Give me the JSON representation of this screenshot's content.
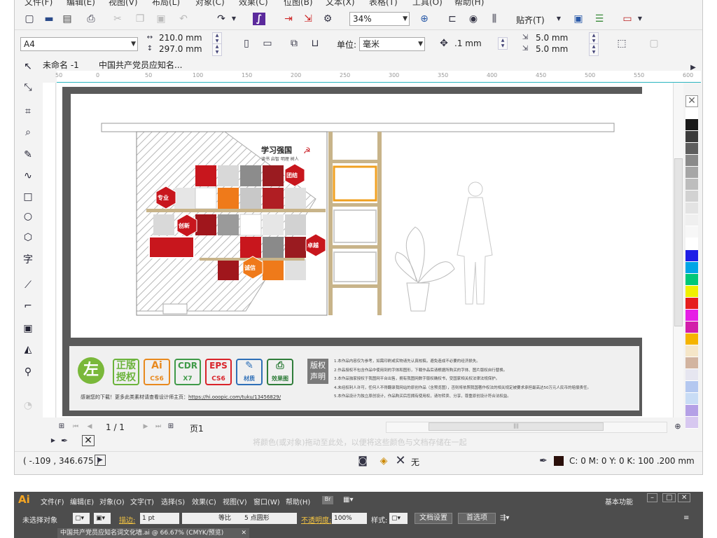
{
  "corel": {
    "menu": [
      "文件(F)",
      "编辑(E)",
      "视图(V)",
      "布局(L)",
      "对象(C)",
      "效果(C)",
      "位图(B)",
      "文本(X)",
      "表格(T)",
      "工具(O)",
      "帮助(H)"
    ],
    "toolbar1": {
      "zoom": "34%",
      "snap": "贴齐(T)"
    },
    "propbar": {
      "page_size": "A4",
      "width": "210.0 mm",
      "height": "297.0 mm",
      "units_label": "单位:",
      "units": "毫米",
      "nudge": ".1 mm",
      "dup_x": "5.0 mm",
      "dup_y": "5.0 mm"
    },
    "doc_tabs": [
      "未命名 -1",
      "中国共产党员应知名..."
    ],
    "ruler_marks": [
      "50",
      "0",
      "50",
      "100",
      "150",
      "200",
      "250",
      "300",
      "350",
      "400",
      "450",
      "500",
      "550",
      "600"
    ],
    "artwork": {
      "title": "学习强国",
      "subtitle": "读书 启智 明理 树人",
      "hex_labels": [
        "专业",
        "创新",
        "团结",
        "诚信",
        "卓越"
      ]
    },
    "footer": {
      "logo_char": "左",
      "badges": [
        {
          "top": "正版",
          "bottom": "授权",
          "color": "#6bb33b"
        },
        {
          "top": "Ai",
          "bottom": "CS6",
          "color": "#e8891e"
        },
        {
          "top": "CDR",
          "bottom": "X7",
          "color": "#3f9a48"
        },
        {
          "top": "EPS",
          "bottom": "CS6",
          "color": "#d9232a"
        },
        {
          "top": "✎",
          "bottom": "材质",
          "color": "#2e6fb7"
        },
        {
          "top": "⎙",
          "bottom": "效果图",
          "color": "#2f7d3a"
        }
      ],
      "copyright_badge": "版权声明",
      "thanks": "感谢您的下载！更多此类素材请查看设计师主页：",
      "link": "https://hi.ooopic.com/tuku/13456829/",
      "rights": [
        "1.本作品内容仅为参考，如需印刷或实物请先认真校稿，避免造成不必要的经济损失。",
        "2.作品授权不包含作品中使用到的字体和图形，下载作品后请根据所购买的字体、图片版权自行替换。",
        "3.本作品独家授权于我图网平台出售，拥有我图网数字版权确权书，受国家相关权法律法规保护。",
        "4.未经权利人许可，任何人不得翻录我网站的原创作品（含预览图），否则将依照我国著作权法的相关规定被要求承担最高达50万元人民币的赔偿责任。",
        "5.本作品设计为独立原创设计，作品购买后您拥有使用权，请勿转卖、分享，尊重原创设计符合法权益。"
      ]
    },
    "pager": {
      "page_of": "1 / 1",
      "page_tab": "页1"
    },
    "hint_text": "将颜色(或对象)拖动至此处，以便将这些颜色与文档存储在一起",
    "status": {
      "coords": "( -.109 , 346.675 )",
      "fill": "无",
      "outline": "C: 0 M: 0 Y: 0 K: 100  .200 mm"
    },
    "palette": [
      "#ffffff",
      "#1a1a1a",
      "#3b3b3b",
      "#5e5e5e",
      "#8a8a8a",
      "#a6a6a6",
      "#bdbdbd",
      "#d2d2d2",
      "#e3e3e3",
      "#efefef",
      "#f7f7f7",
      "#ffffff",
      "#1e1ee6",
      "#00a5e6",
      "#00c878",
      "#f0f000",
      "#e61e1e",
      "#e61ee6",
      "#d21eaa",
      "#f5b400",
      "#f5e6c8",
      "#d2b4a0",
      "#e6e6f0",
      "#b4c8f0",
      "#c8dcf5",
      "#b4a0e6",
      "#d7c8f0"
    ]
  },
  "ai": {
    "logo": "Ai",
    "menu": [
      "文件(F)",
      "编辑(E)",
      "对象(O)",
      "文字(T)",
      "选择(S)",
      "效果(C)",
      "视图(V)",
      "窗口(W)",
      "帮助(H)"
    ],
    "workspace": "基本功能",
    "control": {
      "selection": "未选择对象",
      "stroke_label": "描边:",
      "stroke_value": "1 pt",
      "ratio": "等比",
      "brush": "5 点圆形",
      "opacity_label": "不透明度:",
      "opacity": "100%",
      "style_label": "样式:",
      "doc_setup": "文档设置",
      "prefs": "首选项"
    },
    "doc_tab": "中国共产党员应知名词文化墙.ai @ 66.67% (CMYK/预览)"
  }
}
